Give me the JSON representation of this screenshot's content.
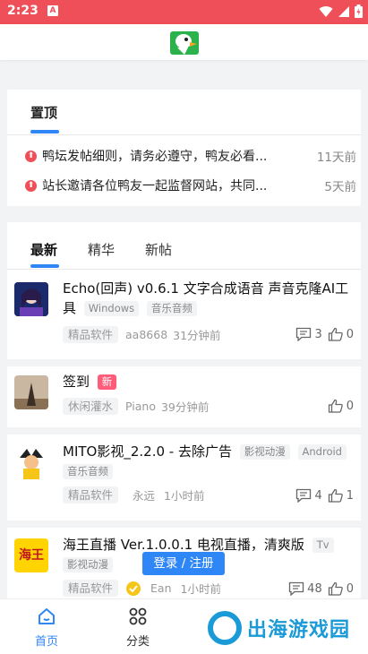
{
  "status_bar": {
    "time": "2:23",
    "app_icon_glyph": "A"
  },
  "pinned": {
    "tab_label": "置顶",
    "items": [
      {
        "text": "鸭坛发帖细则，请务必遵守，鸭友必看...",
        "time": "11天前"
      },
      {
        "text": "站长邀请各位鸭友一起监督网站，共同...",
        "time": "5天前"
      }
    ]
  },
  "feed": {
    "tabs": [
      {
        "label": "最新"
      },
      {
        "label": "精华"
      },
      {
        "label": "新帖"
      }
    ],
    "posts": [
      {
        "title": "Echo(回声) v0.6.1 文字合成语音 声音克隆AI工具",
        "title_line1": "Echo(回声) v0.6.1 文字合成语音 声音克隆AI工",
        "title_line2": "具",
        "tags": [
          "Windows",
          "音乐音频"
        ],
        "category": "精品软件",
        "user": "aa8668",
        "time": "31分钟前",
        "comments": "3",
        "likes": "0"
      },
      {
        "title": "签到",
        "badge": "新",
        "category": "休闲灌水",
        "user": "Piano",
        "time": "39分钟前",
        "likes": "0"
      },
      {
        "title": "MITO影视_2.2.0 - 去除广告",
        "tags": [
          "影视动漫",
          "Android",
          "音乐音频"
        ],
        "category": "精品软件",
        "user": "永远",
        "time": "1小时前",
        "comments": "4",
        "likes": "1"
      },
      {
        "title": "海王直播 Ver.1.0.0.1 电视直播，清爽版",
        "tags": [
          "Tv",
          "影视动漫"
        ],
        "avatar_text": "海王",
        "category": "精品软件",
        "user": "Ean",
        "time": "1小时前",
        "comments": "48",
        "likes": "0"
      }
    ]
  },
  "login_button": "登录 / 注册",
  "bottom_nav": [
    {
      "label": "首页",
      "icon": "home-icon",
      "active": true
    },
    {
      "label": "分类",
      "icon": "grid-icon",
      "active": false
    }
  ],
  "watermark": "出海游戏园",
  "colors": {
    "accent": "#2f86f6",
    "status_bar": "#ee4f58",
    "pin_icon": "#ee4f58",
    "new_badge": "#ff5c7a"
  }
}
